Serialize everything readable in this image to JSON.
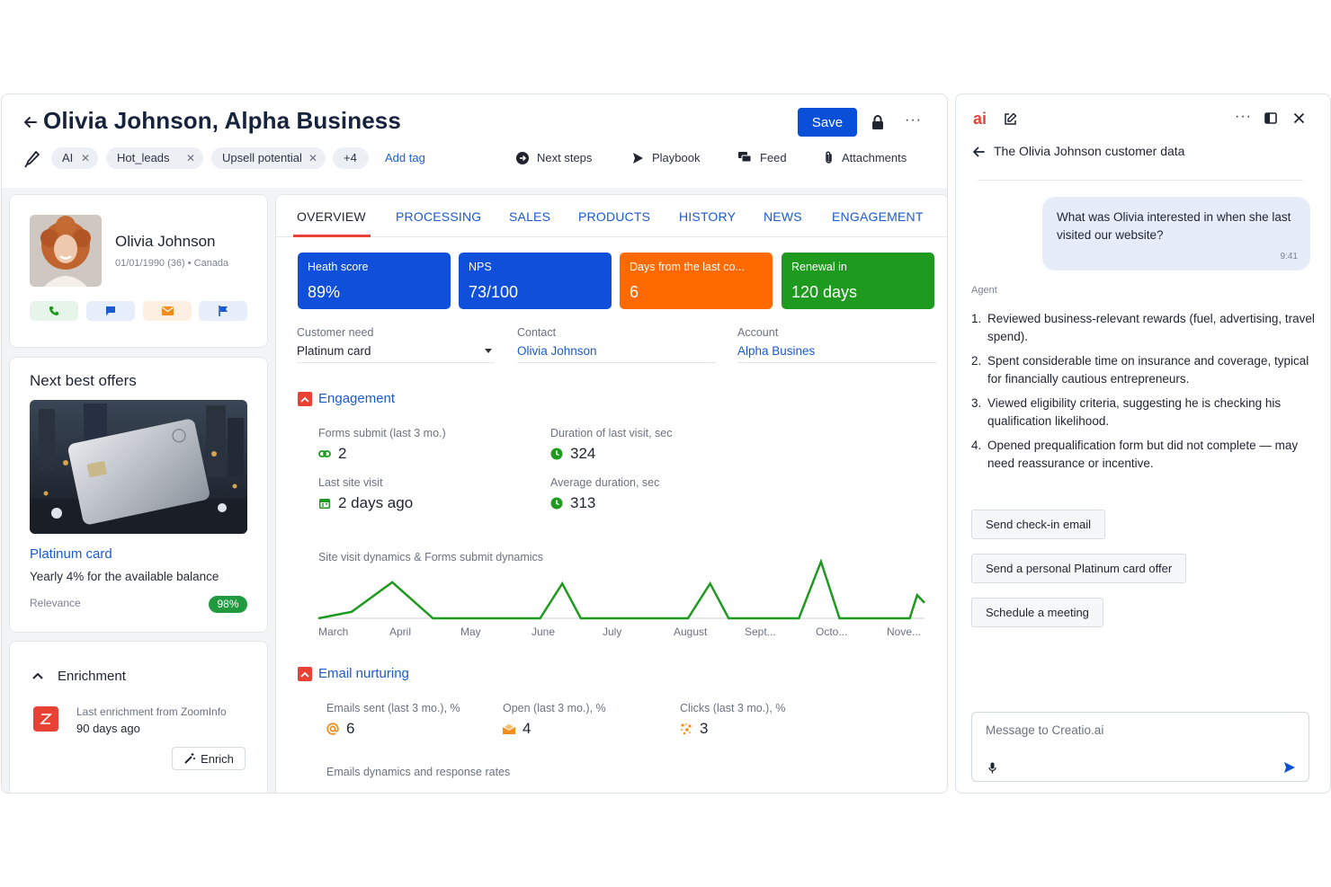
{
  "header": {
    "title": "Olivia Johnson, Alpha Business",
    "save_label": "Save",
    "more_label": "···"
  },
  "tags": [
    {
      "label": "AI"
    },
    {
      "label": "Hot_leads"
    },
    {
      "label": "Upsell potential"
    },
    {
      "label": "+4"
    }
  ],
  "add_tag_label": "Add tag",
  "actions": {
    "next_steps": "Next steps",
    "playbook": "Playbook",
    "feed": "Feed",
    "attachments": "Attachments"
  },
  "contact": {
    "name": "Olivia Johnson",
    "meta": "01/01/1990 (36) • Canada"
  },
  "offers": {
    "title": "Next best offers",
    "name": "Platinum card",
    "description": "Yearly 4% for the available balance",
    "relevance_label": "Relevance",
    "relevance_value": "98%"
  },
  "enrichment": {
    "title": "Enrichment",
    "label": "Last enrichment from ZoomInfo",
    "value": "90 days ago",
    "button": "Enrich"
  },
  "tabs": [
    "OVERVIEW",
    "PROCESSING",
    "SALES",
    "PRODUCTS",
    "HISTORY",
    "NEWS",
    "ENGAGEMENT"
  ],
  "kpis": [
    {
      "label": "Heath score",
      "value": "89%",
      "color": "#0f4fd9"
    },
    {
      "label": "NPS",
      "value": "73/100",
      "color": "#0f4fd9"
    },
    {
      "label": "Days from the last co...",
      "value": "6",
      "color": "#ff6a00"
    },
    {
      "label": "Renewal in",
      "value": "120 days",
      "color": "#1e9a1e"
    }
  ],
  "fields": {
    "customer_need": {
      "label": "Customer need",
      "value": "Platinum card"
    },
    "contact": {
      "label": "Contact",
      "value": "Olivia Johnson"
    },
    "account": {
      "label": "Account",
      "value": "Alpha Busines"
    }
  },
  "engagement": {
    "title": "Engagement",
    "forms_submit": {
      "label": "Forms submit (last 3 mo.)",
      "value": "2"
    },
    "duration_last": {
      "label": "Duration of last visit, sec",
      "value": "324"
    },
    "last_visit": {
      "label": "Last site visit",
      "value": "2 days ago"
    },
    "avg_duration": {
      "label": "Average duration, sec",
      "value": "313"
    }
  },
  "chart_data": {
    "type": "line",
    "title": "Site visit dynamics & Forms submit dynamics",
    "categories": [
      "March",
      "April",
      "May",
      "June",
      "July",
      "August",
      "Sept...",
      "Octo...",
      "Nove..."
    ],
    "x": [
      0,
      0.45,
      1,
      1.55,
      2,
      2.5,
      3,
      3.3,
      3.55,
      4,
      4.5,
      5,
      5.3,
      5.55,
      6,
      6.5,
      6.8,
      7.05,
      7.6,
      8.0,
      8.1,
      8.2
    ],
    "values": [
      0,
      0.25,
      1.4,
      0,
      0,
      0,
      0,
      1.35,
      0,
      0,
      0,
      0,
      1.35,
      0,
      0,
      0,
      2.2,
      0,
      0,
      0,
      0.9,
      0.6
    ],
    "series_color": "#1e9a1e",
    "grid": false
  },
  "email": {
    "title": "Email nurturing",
    "sent": {
      "label": "Emails sent (last 3 mo.), %",
      "value": "6"
    },
    "open": {
      "label": "Open (last 3 mo.), %",
      "value": "4"
    },
    "clicks": {
      "label": "Clicks (last 3 mo.), %",
      "value": "3"
    },
    "dynamics_title": "Emails dynamics and response rates"
  },
  "ai": {
    "logo": "ai",
    "chat_title": "The Olivia Johnson customer data",
    "question": "What was Olivia interested in when she last visited our website?",
    "question_time": "9:41",
    "agent_label": "Agent",
    "answers": [
      "Reviewed business-relevant rewards (fuel, advertising, travel spend).",
      "Spent considerable time on insurance and coverage, typical for financially cautious entrepreneurs.",
      "Viewed eligibility criteria, suggesting he is checking his qualification likelihood.",
      "Opened prequalification form but did not complete — may need reassurance or incentive."
    ],
    "suggestions": [
      "Send check-in email",
      "Send a personal Platinum card offer",
      "Schedule a meeting"
    ],
    "message_placeholder": "Message to Creatio.ai",
    "more_label": "···"
  },
  "colors": {
    "accent_blue": "#0a4fd8",
    "link_blue": "#1a5bd1",
    "brand_red": "#e94235",
    "green": "#1e9a1e",
    "orange": "#ff6a00"
  }
}
